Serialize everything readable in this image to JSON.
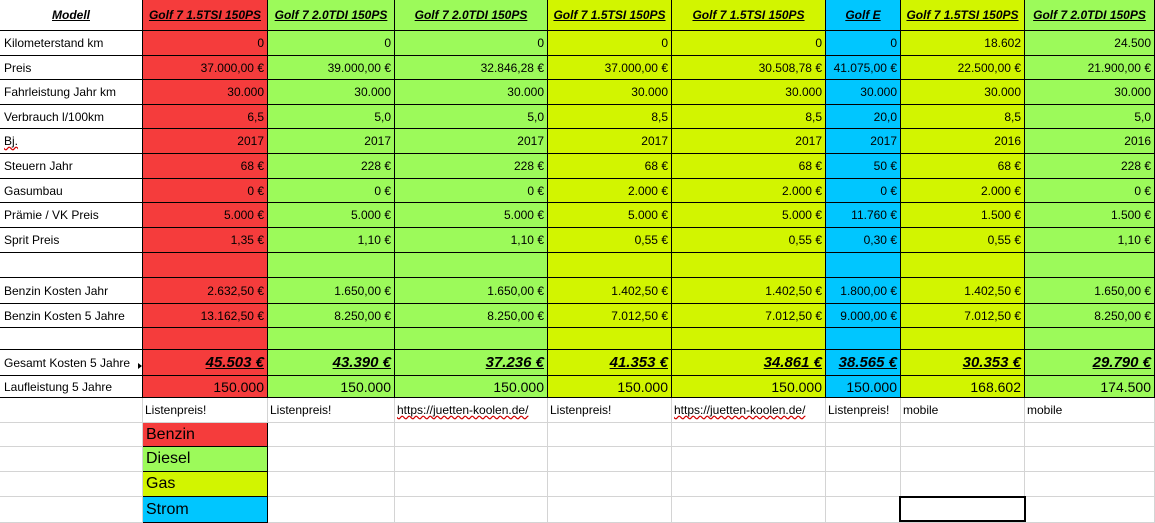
{
  "colors": {
    "benzin": "#f53c3c",
    "diesel": "#9cfa5a",
    "gas": "#d2f500",
    "strom": "#00c6ff",
    "gridline": "#d4d4d4"
  },
  "header": {
    "label": "Modell",
    "models": [
      "Golf 7 1.5TSI 150PS",
      "Golf 7 2.0TDI  150PS",
      "Golf 7 2.0TDI  150PS",
      "Golf 7 1.5TSI 150PS",
      "Golf 7 1.5TSI 150PS",
      "Golf E",
      "Golf 7 1.5TSI 150PS",
      "Golf 7 2.0TDI  150PS"
    ]
  },
  "rows": [
    {
      "label": "Kilometerstand km",
      "values": [
        "0",
        "0",
        "0",
        "0",
        "0",
        "0",
        "18.602",
        "24.500"
      ]
    },
    {
      "label": "Preis",
      "values": [
        "37.000,00 €",
        "39.000,00 €",
        "32.846,28 €",
        "37.000,00 €",
        "30.508,78 €",
        "41.075,00 €",
        "22.500,00 €",
        "21.900,00 €"
      ]
    },
    {
      "label": "Fahrleistung Jahr km",
      "values": [
        "30.000",
        "30.000",
        "30.000",
        "30.000",
        "30.000",
        "30.000",
        "30.000",
        "30.000"
      ]
    },
    {
      "label": "Verbrauch l/100km",
      "values": [
        "6,5",
        "5,0",
        "5,0",
        "8,5",
        "8,5",
        "20,0",
        "8,5",
        "5,0"
      ]
    },
    {
      "label": "Bj.",
      "values": [
        "2017",
        "2017",
        "2017",
        "2017",
        "2017",
        "2017",
        "2016",
        "2016"
      ]
    },
    {
      "label": "Steuern Jahr",
      "values": [
        "68 €",
        "228 €",
        "228 €",
        "68 €",
        "68 €",
        "50 €",
        "68 €",
        "228 €"
      ]
    },
    {
      "label": "Gasumbau",
      "values": [
        "0 €",
        "0 €",
        "0 €",
        "2.000 €",
        "2.000 €",
        "0 €",
        "2.000 €",
        "0 €"
      ]
    },
    {
      "label": "Prämie / VK Preis",
      "values": [
        "5.000 €",
        "5.000 €",
        "5.000 €",
        "5.000 €",
        "5.000 €",
        "11.760 €",
        "1.500 €",
        "1.500 €"
      ]
    },
    {
      "label": "Sprit Preis",
      "values": [
        "1,35 €",
        "1,10 €",
        "1,10 €",
        "0,55 €",
        "0,55 €",
        "0,30 €",
        "0,55 €",
        "1,10 €"
      ]
    },
    {
      "label": "",
      "values": [
        "",
        "",
        "",
        "",
        "",
        "",
        "",
        ""
      ]
    },
    {
      "label": "Benzin Kosten Jahr",
      "values": [
        "2.632,50 €",
        "1.650,00 €",
        "1.650,00 €",
        "1.402,50 €",
        "1.402,50 €",
        "1.800,00 €",
        "1.402,50 €",
        "1.650,00 €"
      ]
    },
    {
      "label": "Benzin Kosten 5 Jahre",
      "values": [
        "13.162,50 €",
        "8.250,00 €",
        "8.250,00 €",
        "7.012,50 €",
        "7.012,50 €",
        "9.000,00 €",
        "7.012,50 €",
        "8.250,00 €"
      ]
    },
    {
      "label": "",
      "values": [
        "",
        "",
        "",
        "",
        "",
        "",
        "",
        ""
      ]
    },
    {
      "label": "Gesamt Kosten 5 Jahre",
      "values": [
        "45.503 €",
        "43.390 €",
        "37.236 €",
        "41.353 €",
        "34.861 €",
        "38.565 €",
        "30.353 €",
        "29.790 €"
      ]
    },
    {
      "label": "Laufleistung 5 Jahre",
      "values": [
        "150.000",
        "150.000",
        "150.000",
        "150.000",
        "150.000",
        "150.000",
        "168.602",
        "174.500"
      ]
    }
  ],
  "sources": [
    "Listenpreis!",
    "Listenpreis!",
    "https://juetten-koolen.de/",
    "Listenpreis!",
    "https://juetten-koolen.de/",
    "Listenpreis!",
    "mobile",
    "mobile"
  ],
  "legend": [
    "Benzin",
    "Diesel",
    "Gas",
    "Strom"
  ]
}
